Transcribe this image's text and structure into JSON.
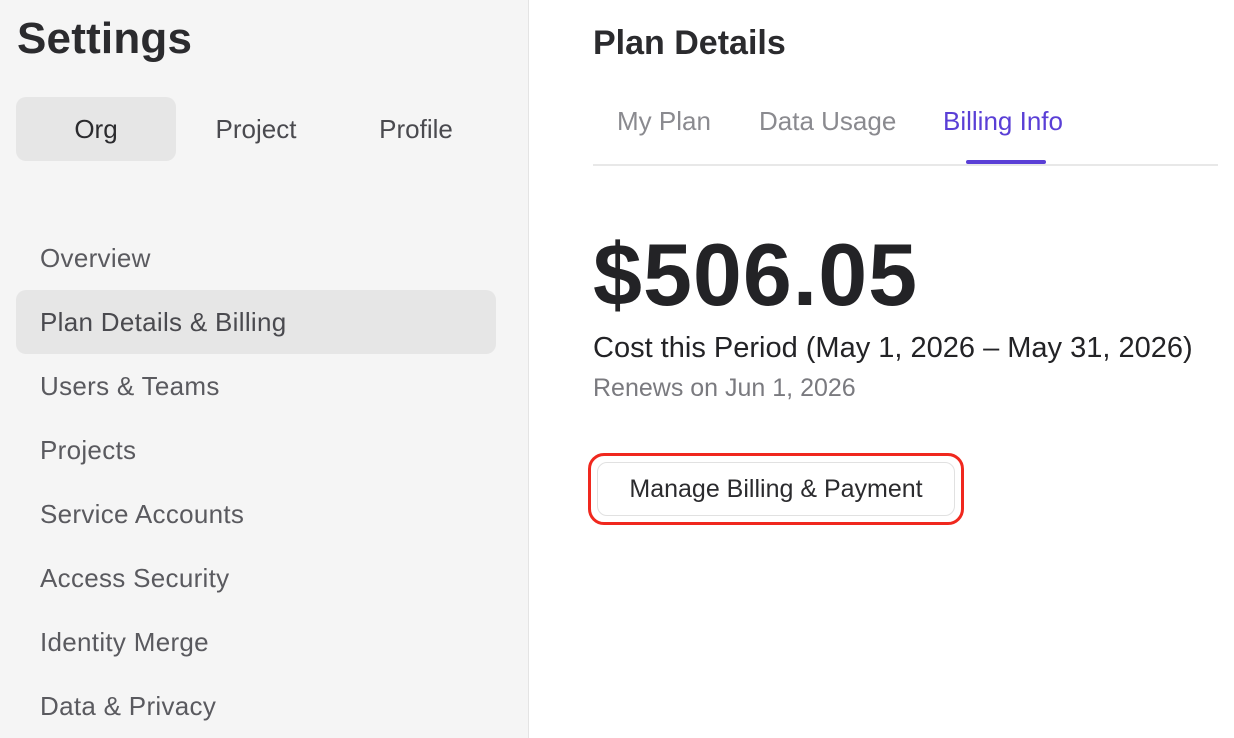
{
  "sidebar": {
    "title": "Settings",
    "scope_tabs": [
      {
        "label": "Org",
        "active": true
      },
      {
        "label": "Project",
        "active": false
      },
      {
        "label": "Profile",
        "active": false
      }
    ],
    "items": [
      {
        "label": "Overview",
        "active": false
      },
      {
        "label": "Plan Details & Billing",
        "active": true
      },
      {
        "label": "Users & Teams",
        "active": false
      },
      {
        "label": "Projects",
        "active": false
      },
      {
        "label": "Service Accounts",
        "active": false
      },
      {
        "label": "Access Security",
        "active": false
      },
      {
        "label": "Identity Merge",
        "active": false
      },
      {
        "label": "Data & Privacy",
        "active": false
      }
    ]
  },
  "main": {
    "title": "Plan Details",
    "tabs": [
      {
        "label": "My Plan",
        "active": false
      },
      {
        "label": "Data Usage",
        "active": false
      },
      {
        "label": "Billing Info",
        "active": true
      }
    ],
    "amount": "$506.05",
    "period": "Cost this Period (May 1, 2026 – May 31, 2026)",
    "renews": "Renews on Jun 1, 2026",
    "manage_button": "Manage Billing & Payment"
  },
  "colors": {
    "accent": "#5a3fd6",
    "highlight_outline": "#f0281e",
    "sidebar_bg": "#f5f5f5",
    "active_item_bg": "#e6e6e6"
  }
}
